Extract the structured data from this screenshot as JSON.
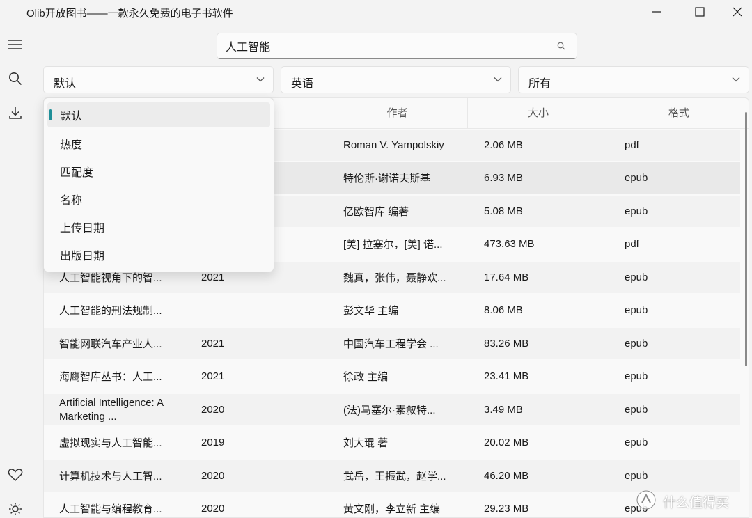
{
  "window": {
    "title": "Olib开放图书——一款永久免费的电子书软件"
  },
  "search": {
    "value": "人工智能"
  },
  "filters": {
    "sort": "默认",
    "language": "英语",
    "type": "所有"
  },
  "table": {
    "headers": [
      "作者",
      "大小",
      "格式"
    ],
    "rows": [
      {
        "name": "",
        "year": "",
        "author": "Roman V. Yampolskiy",
        "size": "2.06 MB",
        "format": "pdf"
      },
      {
        "name": "",
        "year": "",
        "author": "特伦斯·谢诺夫斯基",
        "size": "6.93 MB",
        "format": "epub"
      },
      {
        "name": "",
        "year": "",
        "author": "亿欧智库 编著",
        "size": "5.08 MB",
        "format": "epub"
      },
      {
        "name": "",
        "year": "",
        "author": "[美] 拉塞尔，[美] 诺...",
        "size": "473.63 MB",
        "format": "pdf"
      },
      {
        "name": "人工智能视角下的智...",
        "year": "2021",
        "author": "魏真，张伟，聂静欢...",
        "size": "17.64 MB",
        "format": "epub"
      },
      {
        "name": "人工智能的刑法规制...",
        "year": "",
        "author": "彭文华 主编",
        "size": "8.06 MB",
        "format": "epub"
      },
      {
        "name": "智能网联汽车产业人...",
        "year": "2021",
        "author": "中国汽车工程学会 ...",
        "size": "83.26 MB",
        "format": "epub"
      },
      {
        "name": "海鹰智库丛书：人工...",
        "year": "2021",
        "author": "徐政 主编",
        "size": "23.41 MB",
        "format": "epub"
      },
      {
        "name": "Artificial Intelligence: A Marketing ...",
        "year": "2020",
        "author": "(法)马塞尔·素叙特...",
        "size": "3.49 MB",
        "format": "epub"
      },
      {
        "name": "虚拟现实与人工智能...",
        "year": "2019",
        "author": "刘大琨 著",
        "size": "20.02 MB",
        "format": "epub"
      },
      {
        "name": "计算机技术与人工智...",
        "year": "2020",
        "author": "武岳，王振武，赵学...",
        "size": "46.20 MB",
        "format": "epub"
      },
      {
        "name": "人工智能与编程教育...",
        "year": "2020",
        "author": "黄文刚，李立新 主编",
        "size": "29.23 MB",
        "format": "epub"
      }
    ]
  },
  "sort_menu": {
    "options": [
      "默认",
      "热度",
      "匹配度",
      "名称",
      "上传日期",
      "出版日期"
    ],
    "selected_index": 0
  },
  "watermark": {
    "text": "什么值得买"
  },
  "colors": {
    "accent": "#1f8f98",
    "background": "#f3f3f3"
  }
}
